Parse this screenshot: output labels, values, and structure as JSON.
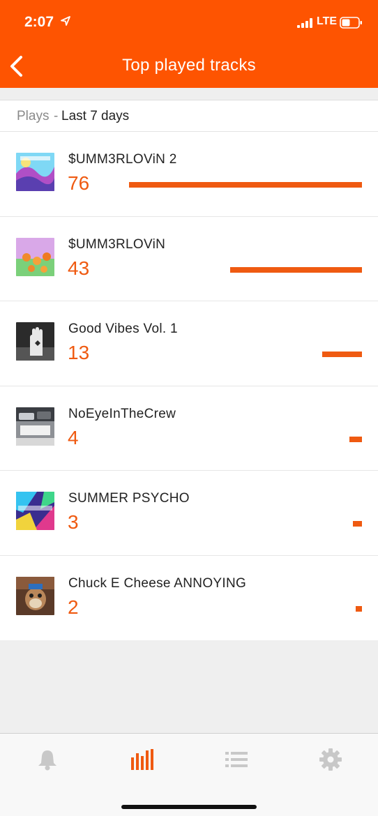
{
  "status_bar": {
    "time": "2:07",
    "network": "LTE"
  },
  "nav": {
    "title": "Top played tracks"
  },
  "header": {
    "label": "Plays",
    "separator": "-",
    "range": "Last 7 days"
  },
  "tracks": [
    {
      "title": "$UMM3RLOViN 2",
      "plays": 76
    },
    {
      "title": "$UMM3RLOViN",
      "plays": 43
    },
    {
      "title": "Good Vibes Vol. 1",
      "plays": 13
    },
    {
      "title": "NoEyeInTheCrew",
      "plays": 4
    },
    {
      "title": "SUMMER PSYCHO",
      "plays": 3
    },
    {
      "title": "Chuck E Cheese ANNOYING",
      "plays": 2
    }
  ],
  "tabs": [
    {
      "icon": "bell-icon",
      "active": false
    },
    {
      "icon": "stats-bars-icon",
      "active": true
    },
    {
      "icon": "list-icon",
      "active": false
    },
    {
      "icon": "gear-icon",
      "active": false
    }
  ],
  "colors": {
    "accent": "#fe5401",
    "bar": "#ef5a11",
    "inactive_icon": "#c8c8c8"
  }
}
